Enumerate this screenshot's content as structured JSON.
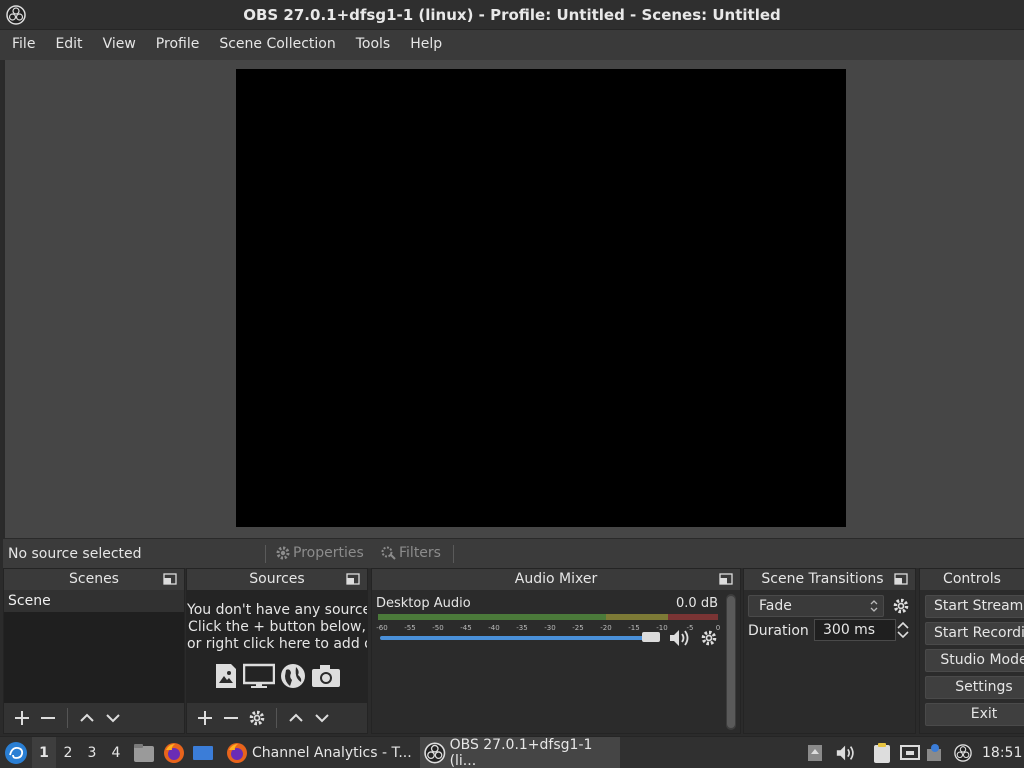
{
  "window": {
    "title": "OBS 27.0.1+dfsg1-1 (linux) - Profile: Untitled - Scenes: Untitled"
  },
  "menu": [
    "File",
    "Edit",
    "View",
    "Profile",
    "Scene Collection",
    "Tools",
    "Help"
  ],
  "source_toolbar": {
    "status": "No source selected",
    "properties_label": "Properties",
    "filters_label": "Filters"
  },
  "scenes": {
    "title": "Scenes",
    "items": [
      "Scene"
    ]
  },
  "sources": {
    "title": "Sources",
    "empty_lines": [
      "You don't have any sources.",
      "Click the + button below,",
      "or right click here to add one."
    ]
  },
  "audio_mixer": {
    "title": "Audio Mixer",
    "channels": [
      {
        "name": "Desktop Audio",
        "level": "0.0 dB",
        "volume": 1.0
      }
    ],
    "scale": [
      "-60",
      "-55",
      "-50",
      "-45",
      "-40",
      "-35",
      "-30",
      "-25",
      "-20",
      "-15",
      "-10",
      "-5",
      "0"
    ]
  },
  "transitions": {
    "title": "Scene Transitions",
    "selected": "Fade",
    "duration_label": "Duration",
    "duration_value": "300 ms"
  },
  "controls": {
    "title": "Controls",
    "buttons": [
      "Start Streaming",
      "Start Recording",
      "Studio Mode",
      "Settings",
      "Exit"
    ]
  },
  "taskbar": {
    "workspaces": [
      "1",
      "2",
      "3",
      "4"
    ],
    "active_workspace": "1",
    "tasks": [
      {
        "label": "Channel Analytics - T...",
        "icon": "firefox-icon"
      },
      {
        "label": "OBS 27.0.1+dfsg1-1 (li...",
        "icon": "obs-icon"
      }
    ],
    "clock": "18:51"
  },
  "colors": {
    "accent": "#4a90d9",
    "meter_green": "#4b7a3a",
    "meter_yellow": "#7d7a36",
    "meter_red": "#7a3434"
  }
}
